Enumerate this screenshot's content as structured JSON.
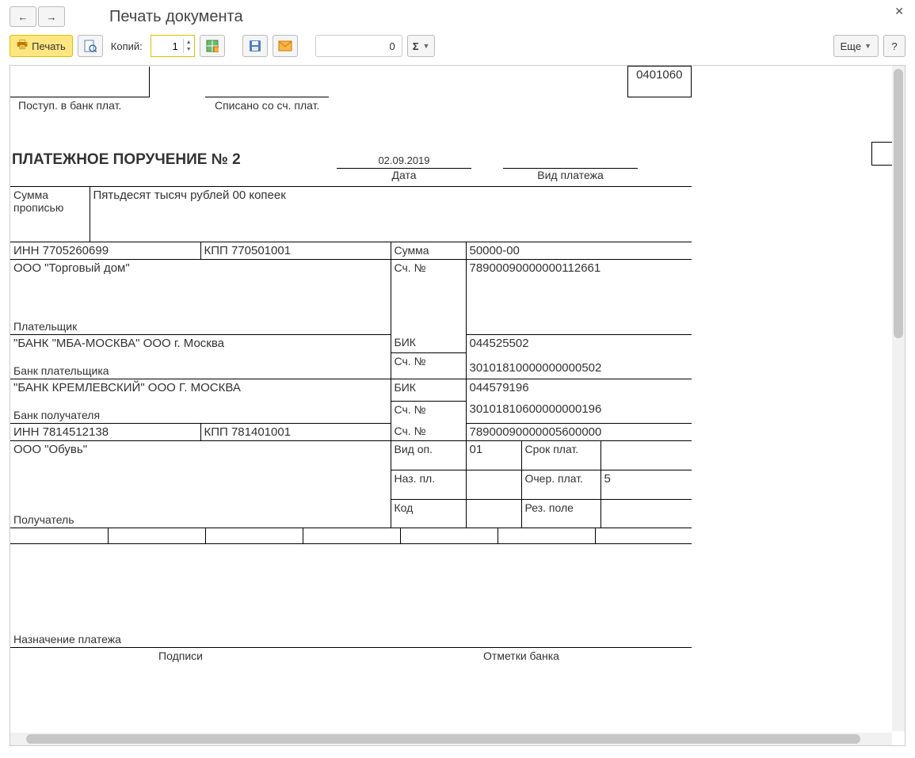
{
  "header": {
    "title": "Печать документа"
  },
  "toolbar": {
    "print_label": "Печать",
    "copies_label": "Копий:",
    "copies_value": "1",
    "num_value": "0",
    "more_label": "Еще",
    "help_label": "?"
  },
  "doc": {
    "code": "0401060",
    "received_label": "Поступ. в банк плат.",
    "writtenoff_label": "Списано со сч. плат.",
    "title": "ПЛАТЕЖНОЕ ПОРУЧЕНИЕ № 2",
    "date": "02.09.2019",
    "date_label": "Дата",
    "paytype_label": "Вид платежа",
    "sum_words_label": "Сумма прописью",
    "sum_words": "Пятьдесят тысяч рублей 00 копеек",
    "payer_inn": "ИНН 7705260699",
    "payer_kpp": "КПП 770501001",
    "sum_label": "Сумма",
    "sum_value": "50000-00",
    "payer_name": "ООО \"Торговый дом\"",
    "acc_label": "Сч. №",
    "payer_acc": "78900090000000112661",
    "payer_label": "Плательщик",
    "payer_bank": "\"БАНК \"МБА-МОСКВА\" ООО г. Москва",
    "bik_label": "БИК",
    "payer_bik": "044525502",
    "payer_bank_corr": "30101810000000000502",
    "payer_bank_label": "Банк плательщика",
    "recv_bank": "\"БАНК КРЕМЛЕВСКИЙ\" ООО Г. МОСКВА",
    "recv_bik": "044579196",
    "recv_bank_corr": "30101810600000000196",
    "recv_bank_label": "Банк получателя",
    "recv_inn": "ИНН 7814512138",
    "recv_kpp": "КПП 781401001",
    "recv_acc": "78900090000005600000",
    "recv_name": "ООО \"Обувь\"",
    "vid_op_label": "Вид оп.",
    "vid_op": "01",
    "srok_label": "Срок плат.",
    "naz_pl_label": "Наз. пл.",
    "ocher_label": "Очер. плат.",
    "ocher": "5",
    "kod_label": "Код",
    "rez_label": "Рез. поле",
    "recv_label": "Получатель",
    "purpose_label": "Назначение платежа",
    "signs_label": "Подписи",
    "bank_marks_label": "Отметки банка"
  }
}
